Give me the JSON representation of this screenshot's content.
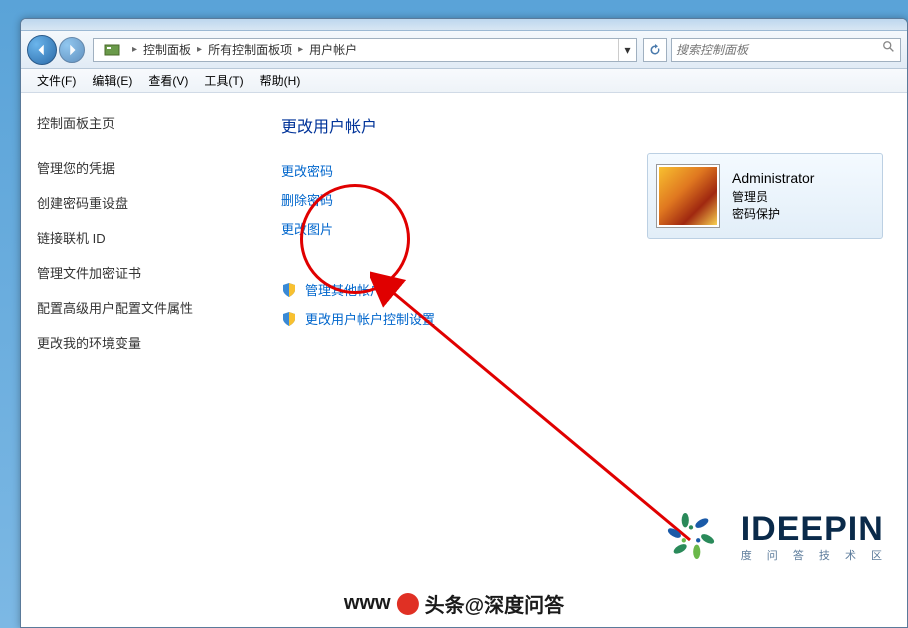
{
  "breadcrumb": {
    "items": [
      "控制面板",
      "所有控制面板项",
      "用户帐户"
    ]
  },
  "search": {
    "placeholder": "搜索控制面板"
  },
  "menubar": {
    "items": [
      {
        "label": "文件(F)"
      },
      {
        "label": "编辑(E)"
      },
      {
        "label": "查看(V)"
      },
      {
        "label": "工具(T)"
      },
      {
        "label": "帮助(H)"
      }
    ]
  },
  "sidebar": {
    "home": "控制面板主页",
    "links": [
      "管理您的凭据",
      "创建密码重设盘",
      "链接联机 ID",
      "管理文件加密证书",
      "配置高级用户配置文件属性",
      "更改我的环境变量"
    ]
  },
  "main": {
    "heading": "更改用户帐户",
    "action_links": [
      "更改密码",
      "删除密码",
      "更改图片"
    ],
    "shield_links": [
      "管理其他帐户",
      "更改用户帐户控制设置"
    ]
  },
  "account": {
    "name": "Administrator",
    "role": "管理员",
    "protection": "密码保护"
  },
  "watermark": {
    "brand": "IDEEPIN",
    "sub": "度 问 答 技 术 区",
    "url_prefix": "www",
    "url_text": "头条@深度问答"
  }
}
